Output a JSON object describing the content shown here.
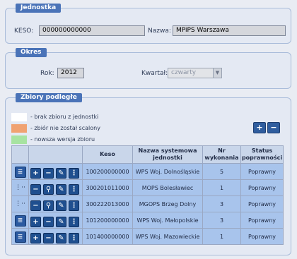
{
  "sections": {
    "jednostka": {
      "title": "Jednostka",
      "keso_label": "KESO:",
      "keso_value": "000000000000",
      "nazwa_label": "Nazwa:",
      "nazwa_value": "MPiPS Warszawa"
    },
    "okres": {
      "title": "Okres",
      "rok_label": "Rok:",
      "rok_value": "2012",
      "kwartal_label": "Kwartał:",
      "kwartal_value": "czwarty"
    },
    "zbiory": {
      "title": "Zbiory podległe",
      "legend": [
        {
          "color": "#ffffff",
          "text": "- brak zbioru z jednostki"
        },
        {
          "color": "#f0a271",
          "text": "- zbiór nie został scalony"
        },
        {
          "color": "#a7e3a1",
          "text": "- nowsza wersja zbioru"
        }
      ],
      "columns": [
        "Keso",
        "Nazwa systemowa jednostki",
        "Nr wykonania",
        "Status poprawności"
      ],
      "rows": [
        {
          "keso": "100200000000",
          "nazwa": "WPS Woj. Dolnośląskie",
          "nr": "5",
          "status": "Poprawny"
        },
        {
          "keso": "300201011000",
          "nazwa": "MOPS Bolesławiec",
          "nr": "1",
          "status": "Poprawny"
        },
        {
          "keso": "300222013000",
          "nazwa": "MGOPS Brzeg Dolny",
          "nr": "3",
          "status": "Poprawny"
        },
        {
          "keso": "101200000000",
          "nazwa": "WPS Woj. Małopolskie",
          "nr": "3",
          "status": "Poprawny"
        },
        {
          "keso": "101400000000",
          "nazwa": "WPS Woj. Mazowieckie",
          "nr": "1",
          "status": "Poprawny"
        }
      ]
    }
  }
}
